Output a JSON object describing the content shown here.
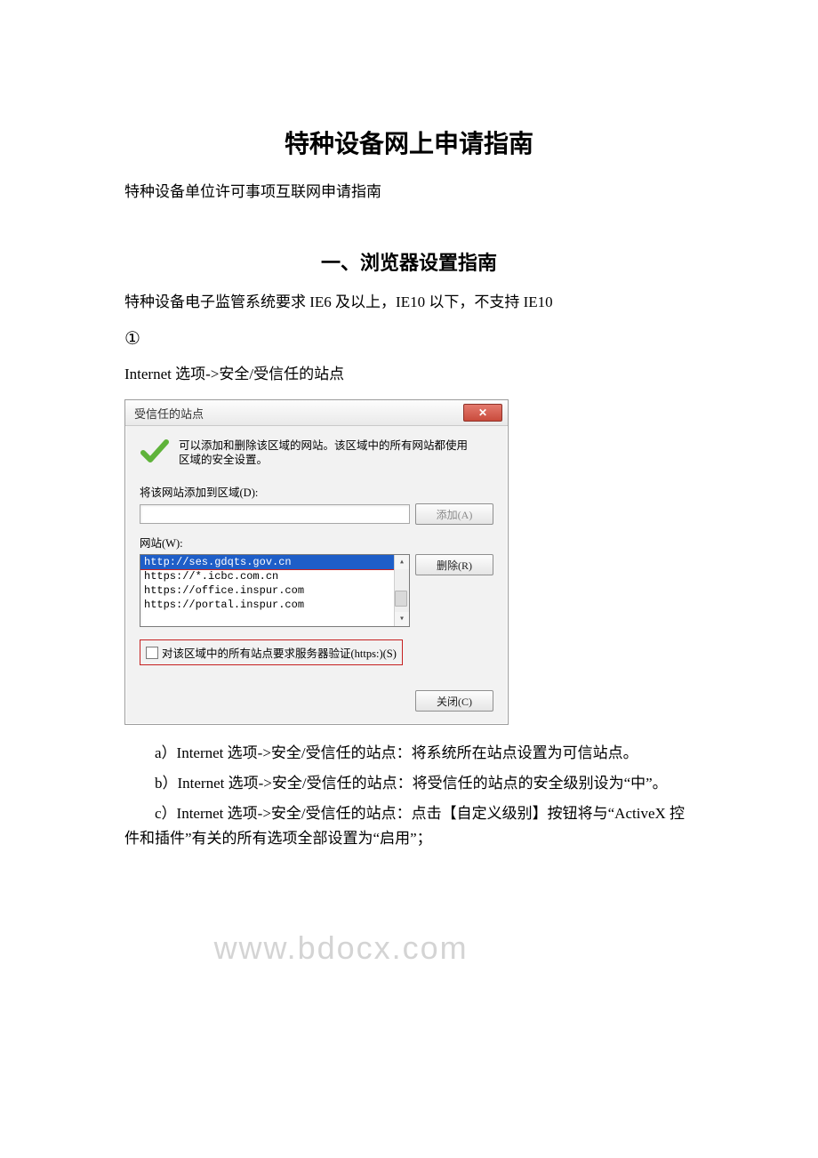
{
  "doc": {
    "title": "特种设备网上申请指南",
    "subtitle": "特种设备单位许可事项互联网申请指南",
    "section1_heading": "一、浏览器设置指南",
    "ie_requirement": "特种设备电子监管系统要求 IE6 及以上，IE10 以下，不支持 IE10",
    "step_marker": "①",
    "step_path": "Internet 选项->安全/受信任的站点",
    "note_a": "a）Internet 选项->安全/受信任的站点：将系统所在站点设置为可信站点。",
    "note_b": "b）Internet 选项->安全/受信任的站点：将受信任的站点的安全级别设为“中”。",
    "note_c": "c）Internet 选项->安全/受信任的站点：点击【自定义级别】按钮将与“ActiveX 控件和插件”有关的所有选项全部设置为“启用”；"
  },
  "dialog": {
    "title": "受信任的站点",
    "info": "可以添加和删除该区域的网站。该区域中的所有网站都使用区域的安全设置。",
    "add_label": "将该网站添加到区域(D):",
    "add_button": "添加(A)",
    "sites_label": "网站(W):",
    "remove_button": "删除(R)",
    "sites": [
      "http://ses.gdqts.gov.cn",
      "https://*.icbc.com.cn",
      "https://office.inspur.com",
      "https://portal.inspur.com"
    ],
    "checkbox_label": "对该区域中的所有站点要求服务器验证(https:)(S)",
    "close_button": "关闭(C)"
  },
  "watermark": "www.bdocx.com"
}
